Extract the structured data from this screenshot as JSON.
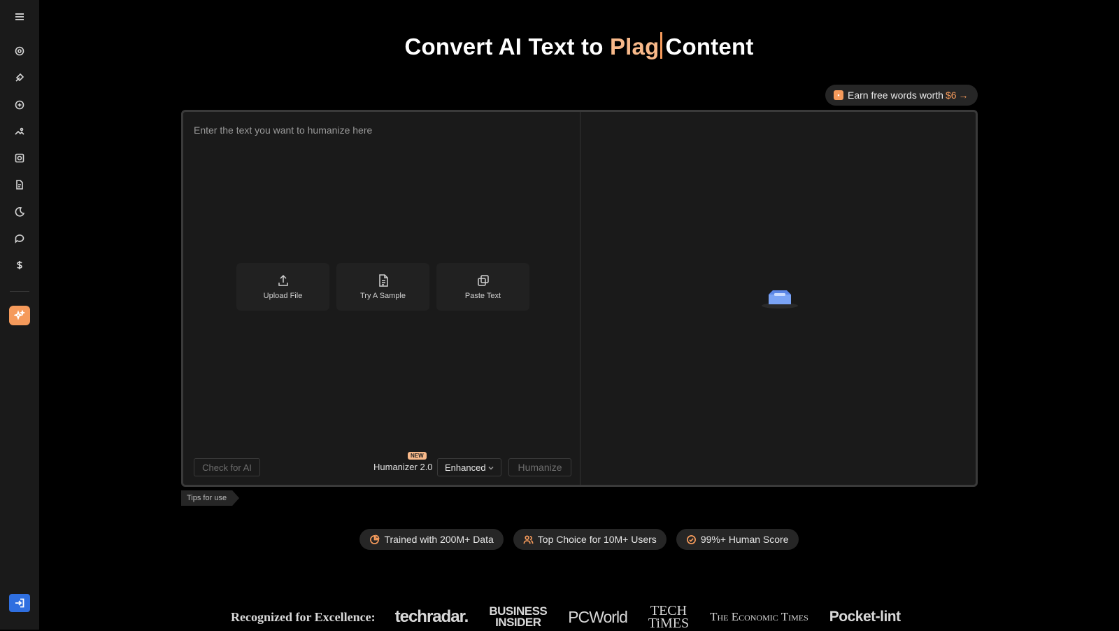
{
  "header": {
    "title_prefix": "Convert AI Text to ",
    "title_accent": "Plag",
    "title_suffix": "Content"
  },
  "earn": {
    "text": "Earn free words worth",
    "amount": "$6",
    "arrow": "→"
  },
  "editor": {
    "placeholder": "Enter the text you want to humanize here",
    "actions": [
      {
        "label": "Upload File",
        "icon": "upload-icon"
      },
      {
        "label": "Try A Sample",
        "icon": "document-icon"
      },
      {
        "label": "Paste Text",
        "icon": "copy-icon"
      }
    ],
    "check_label": "Check for AI",
    "humanizer_label": "Humanizer 2.0",
    "new_badge": "NEW",
    "mode_value": "Enhanced",
    "humanize_label": "Humanize"
  },
  "tips": {
    "label": "Tips for use"
  },
  "features": [
    {
      "label": "Trained with 200M+ Data",
      "icon": "chart-pie-icon"
    },
    {
      "label": "Top Choice for 10M+ Users",
      "icon": "users-icon"
    },
    {
      "label": "99%+ Human Score",
      "icon": "check-circle-icon"
    }
  ],
  "recognition": {
    "label": "Recognized for Excellence:",
    "logos": {
      "techradar": "techradar.",
      "bi_line1": "BUSINESS",
      "bi_line2": "INSIDER",
      "pcworld": "PCWorld",
      "tech_line1": "TECH",
      "tech_line2": "TiMES",
      "et": "The Economic Times",
      "pocketlint": "Pocket-lint"
    }
  },
  "colors": {
    "accent": "#f59a5b",
    "accent_light": "#f8b98a",
    "login_blue": "#2f6fe0"
  }
}
